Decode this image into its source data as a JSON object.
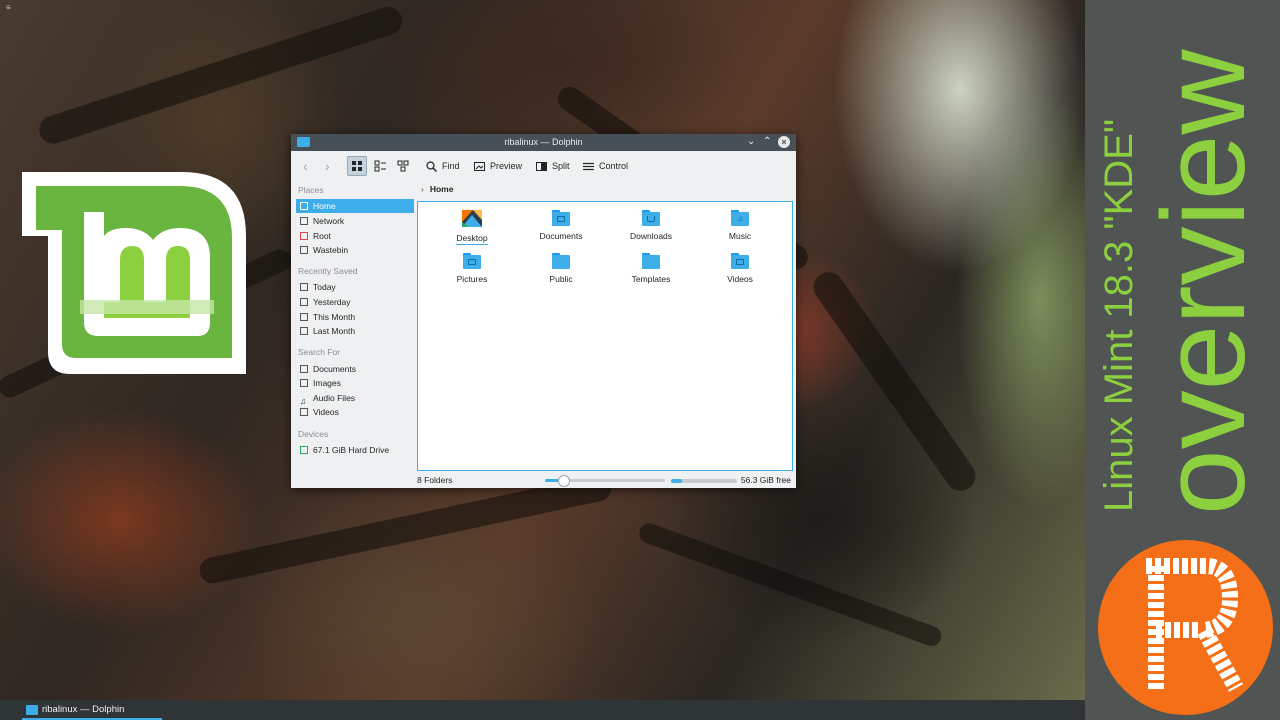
{
  "window": {
    "title": "ribalinux — Dolphin",
    "toolbar": {
      "find": "Find",
      "preview": "Preview",
      "split": "Split",
      "control": "Control"
    },
    "sidebar": {
      "places_header": "Places",
      "places": [
        {
          "label": "Home",
          "icon": "home-icon",
          "active": true
        },
        {
          "label": "Network",
          "icon": "network-icon"
        },
        {
          "label": "Root",
          "icon": "root-icon"
        },
        {
          "label": "Wastebin",
          "icon": "trash-icon"
        }
      ],
      "recent_header": "Recently Saved",
      "recent": [
        {
          "label": "Today",
          "icon": "calendar-icon"
        },
        {
          "label": "Yesterday",
          "icon": "calendar-icon"
        },
        {
          "label": "This Month",
          "icon": "calendar-icon"
        },
        {
          "label": "Last Month",
          "icon": "calendar-icon"
        }
      ],
      "search_header": "Search For",
      "search": [
        {
          "label": "Documents",
          "icon": "document-icon"
        },
        {
          "label": "Images",
          "icon": "image-icon"
        },
        {
          "label": "Audio Files",
          "icon": "music-note-icon"
        },
        {
          "label": "Videos",
          "icon": "video-icon"
        }
      ],
      "devices_header": "Devices",
      "devices": [
        {
          "label": "67.1 GiB Hard Drive",
          "icon": "drive-icon"
        }
      ]
    },
    "breadcrumb": "Home",
    "folders": [
      {
        "name": "Desktop",
        "icon": "desktop-folder-icon",
        "selected": true
      },
      {
        "name": "Documents",
        "icon": "documents-folder-icon"
      },
      {
        "name": "Downloads",
        "icon": "downloads-folder-icon"
      },
      {
        "name": "Music",
        "icon": "music-folder-icon"
      },
      {
        "name": "Pictures",
        "icon": "pictures-folder-icon"
      },
      {
        "name": "Public",
        "icon": "public-folder-icon"
      },
      {
        "name": "Templates",
        "icon": "templates-folder-icon"
      },
      {
        "name": "Videos",
        "icon": "videos-folder-icon"
      }
    ],
    "status": {
      "count": "8 Folders",
      "zoom_fraction": 0.15,
      "free": "56.3 GiB free",
      "used_fraction": 0.16
    }
  },
  "taskbar": {
    "task_label": "ribalinux — Dolphin"
  },
  "overlay": {
    "subtitle": "Linux Mint 18.3 \"KDE\"",
    "heading": "overview",
    "badge_letter": "R"
  },
  "colors": {
    "accent": "#3daee9",
    "mint_green": "#8ccf3f",
    "badge_orange": "#f46f17",
    "panel_gray": "#505554"
  }
}
